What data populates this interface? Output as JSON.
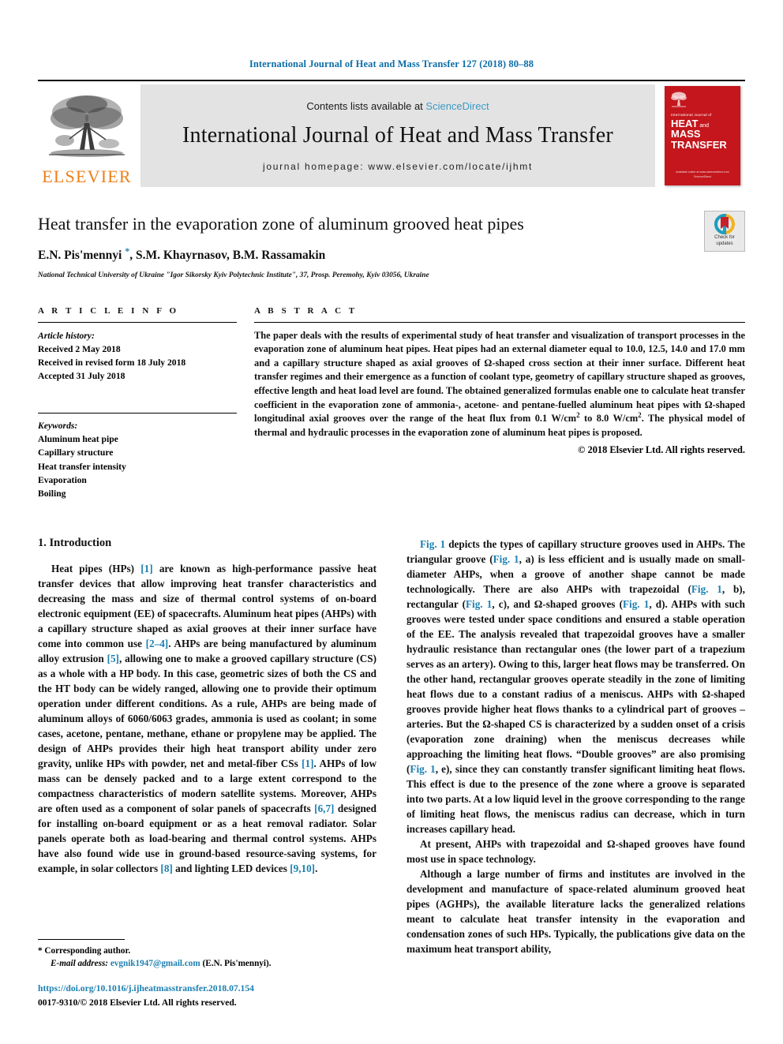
{
  "running_head": "International Journal of Heat and Mass Transfer 127 (2018) 80–88",
  "masthead": {
    "publisher_name": "ELSEVIER",
    "contents_prefix": "Contents lists available at ",
    "sciencedirect": "ScienceDirect",
    "journal_title": "International Journal of Heat and Mass Transfer",
    "homepage": "journal homepage: www.elsevier.com/locate/ijhmt",
    "cover": {
      "sub": "International Journal of",
      "line1": "HEAT",
      "and": " and ",
      "line1b": "MASS",
      "line2": "TRANSFER",
      "footer1": "Available online at www.sciencedirect.com",
      "footer2": "ScienceDirect"
    },
    "accent_blue": "#3a9bc6",
    "accent_orange": "#ED7F18",
    "cover_red": "#c4161c"
  },
  "title_block": {
    "title": "Heat transfer in the evaporation zone of aluminum grooved heat pipes",
    "authors_part1": "E.N. Pis'mennyi ",
    "author_star": "*",
    "authors_part2": ", S.M. Khayrnasov, B.M. Rassamakin",
    "affiliation": "National Technical University of Ukraine \"Igor Sikorsky Kyiv Polytechnic Institute\", 37, Prosp. Peremohy, Kyiv 03056, Ukraine",
    "crossmark_label": "Check for\nupdates"
  },
  "article_info": {
    "heading": "A R T I C L E  I N F O",
    "history_label": "Article history:",
    "history": [
      "Received 2 May 2018",
      "Received in revised form 18 July 2018",
      "Accepted 31 July 2018"
    ],
    "keywords_label": "Keywords:",
    "keywords": [
      "Aluminum heat pipe",
      "Capillary structure",
      "Heat transfer intensity",
      "Evaporation",
      "Boiling"
    ]
  },
  "abstract": {
    "heading": "A B S T R A C T",
    "text_part1": "The paper deals with the results of experimental study of heat transfer and visualization of transport processes in the evaporation zone of aluminum heat pipes. Heat pipes had an external diameter equal to 10.0, 12.5, 14.0 and 17.0 mm and a capillary structure shaped as axial grooves of Ω-shaped cross section at their inner surface. Different heat transfer regimes and their emergence as a function of coolant type, geometry of capillary structure shaped as grooves, effective length and heat load level are found. The obtained generalized formulas enable one to calculate heat transfer coefficient in the evaporation zone of ammonia-, acetone- and pentane-fuelled aluminum heat pipes with Ω-shaped longitudinal axial grooves over the range of the heat flux from 0.1 W/cm",
    "sup1": "2",
    "text_part2": " to 8.0 W/cm",
    "sup2": "2",
    "text_part3": ". The physical model of thermal and hydraulic processes in the evaporation zone of aluminum heat pipes is proposed.",
    "copyright": "© 2018 Elsevier Ltd. All rights reserved."
  },
  "body": {
    "section_title": "1. Introduction",
    "left_paragraphs": [
      {
        "segments": [
          {
            "t": "Heat pipes (HPs) ",
            "k": "text"
          },
          {
            "t": "[1]",
            "k": "ref"
          },
          {
            "t": " are known as high-performance passive heat transfer devices that allow improving heat transfer characteristics and decreasing the mass and size of thermal control systems of on-board electronic equipment (EE) of spacecrafts. Aluminum heat pipes (AHPs) with a capillary structure shaped as axial grooves at their inner surface have come into common use ",
            "k": "text"
          },
          {
            "t": "[2–4]",
            "k": "ref"
          },
          {
            "t": ". AHPs are being manufactured by aluminum alloy extrusion ",
            "k": "text"
          },
          {
            "t": "[5]",
            "k": "ref"
          },
          {
            "t": ", allowing one to make a grooved capillary structure (CS) as a whole with a HP body. In this case, geometric sizes of both the CS and the HT body can be widely ranged, allowing one to provide their optimum operation under different conditions. As a rule, AHPs are being made of aluminum alloys of 6060/6063 grades, ammonia is used as coolant; in some cases, acetone, pentane, methane, ethane or propylene may be applied. The design of AHPs provides their high heat transport ability under zero gravity, unlike HPs with powder, net and metal-fiber CSs ",
            "k": "text"
          },
          {
            "t": "[1]",
            "k": "ref"
          },
          {
            "t": ". AHPs of low mass can be densely packed and to a large extent correspond to the compactness characteristics of modern satellite systems. Moreover, AHPs are often used as a component of solar panels of spacecrafts ",
            "k": "text"
          },
          {
            "t": "[6,7]",
            "k": "ref"
          },
          {
            "t": " designed for installing on-board equipment or as a heat removal radiator. Solar panels operate both as load-bearing and thermal control systems. AHPs have also found wide use in ground-based resource-saving systems, for example, in solar collectors ",
            "k": "text"
          },
          {
            "t": "[8]",
            "k": "ref"
          },
          {
            "t": " and lighting LED devices ",
            "k": "text"
          },
          {
            "t": "[9,10]",
            "k": "ref"
          },
          {
            "t": ".",
            "k": "text"
          }
        ]
      }
    ],
    "right_paragraphs": [
      {
        "segments": [
          {
            "t": "Fig. 1",
            "k": "ref"
          },
          {
            "t": " depicts the types of capillary structure grooves used in AHPs. The triangular groove (",
            "k": "text"
          },
          {
            "t": "Fig. 1",
            "k": "ref"
          },
          {
            "t": ", a) is less efficient and is usually made on small-diameter AHPs, when a groove of another shape cannot be made technologically. There are also AHPs with trapezoidal (",
            "k": "text"
          },
          {
            "t": "Fig. 1",
            "k": "ref"
          },
          {
            "t": ", b), rectangular (",
            "k": "text"
          },
          {
            "t": "Fig. 1",
            "k": "ref"
          },
          {
            "t": ", c), and Ω-shaped grooves (",
            "k": "text"
          },
          {
            "t": "Fig. 1",
            "k": "ref"
          },
          {
            "t": ", d). AHPs with such grooves were tested under space conditions and ensured a stable operation of the EE. The analysis revealed that trapezoidal grooves have a smaller hydraulic resistance than rectangular ones (the lower part of a trapezium serves as an artery). Owing to this, larger heat flows may be transferred. On the other hand, rectangular grooves operate steadily in the zone of limiting heat flows due to a constant radius of a meniscus. AHPs with Ω-shaped grooves provide higher heat flows thanks to a cylindrical part of grooves – arteries. But the Ω-shaped CS is characterized by a sudden onset of a crisis (evaporation zone draining) when the meniscus decreases while approaching the limiting heat flows. “Double grooves” are also promising (",
            "k": "text"
          },
          {
            "t": "Fig. 1",
            "k": "ref"
          },
          {
            "t": ", e), since they can constantly transfer significant limiting heat flows. This effect is due to the presence of the zone where a groove is separated into two parts. At a low liquid level in the groove corresponding to the range of limiting heat flows, the meniscus radius can decrease, which in turn increases capillary head.",
            "k": "text"
          }
        ]
      },
      {
        "segments": [
          {
            "t": "At present, AHPs with trapezoidal and Ω-shaped grooves have found most use in space technology.",
            "k": "text"
          }
        ]
      },
      {
        "segments": [
          {
            "t": "Although a large number of firms and institutes are involved in the development and manufacture of space-related aluminum grooved heat pipes (AGHPs), the available literature lacks the generalized relations meant to calculate heat transfer intensity in the evaporation and condensation zones of such HPs. Typically, the publications give data on the maximum heat transport ability,",
            "k": "text"
          }
        ]
      }
    ]
  },
  "footnote": {
    "star": "*",
    "corresponding": " Corresponding author.",
    "email_label": "E-mail address:",
    "email": "evgnik1947@gmail.com",
    "email_owner": " (E.N. Pis'mennyi).",
    "doi": "https://doi.org/10.1016/j.ijheatmasstransfer.2018.07.154",
    "issn": "0017-9310/© 2018 Elsevier Ltd. All rights reserved."
  }
}
